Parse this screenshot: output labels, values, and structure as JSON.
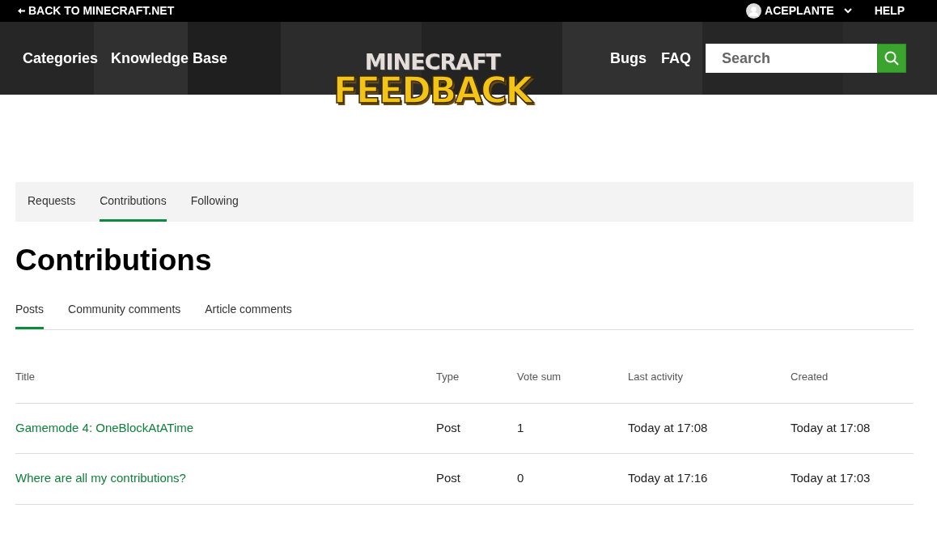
{
  "top_bar": {
    "back_link": "BACK TO MINECRAFT.NET",
    "user": "ACEPLANTE",
    "help": "HELP"
  },
  "header": {
    "nav_left": [
      "Categories",
      "Knowledge Base"
    ],
    "logo": {
      "line_1": "MINECRAFT",
      "line_2": "FEEDBACK"
    },
    "nav_right": [
      "Bugs",
      "FAQ"
    ],
    "search": {
      "placeholder": "Search"
    }
  },
  "tabs": [
    {
      "label": "Requests",
      "selected": false
    },
    {
      "label": "Contributions",
      "selected": true
    },
    {
      "label": "Following",
      "selected": false
    }
  ],
  "heading": "Contributions",
  "sub_tabs": [
    {
      "label": "Posts",
      "selected": true
    },
    {
      "label": "Community comments",
      "selected": false
    },
    {
      "label": "Article comments",
      "selected": false
    }
  ],
  "table": {
    "columns": [
      "Title",
      "Type",
      "Vote sum",
      "Last activity",
      "Created"
    ],
    "rows": [
      [
        "Gamemode 4: OneBlockAtATime",
        "Post",
        "1",
        "Today at 17:08",
        "Today at 17:08"
      ],
      [
        "Where are all my contributions?",
        "Post",
        "0",
        "Today at 17:16",
        "Today at 17:03"
      ]
    ]
  }
}
